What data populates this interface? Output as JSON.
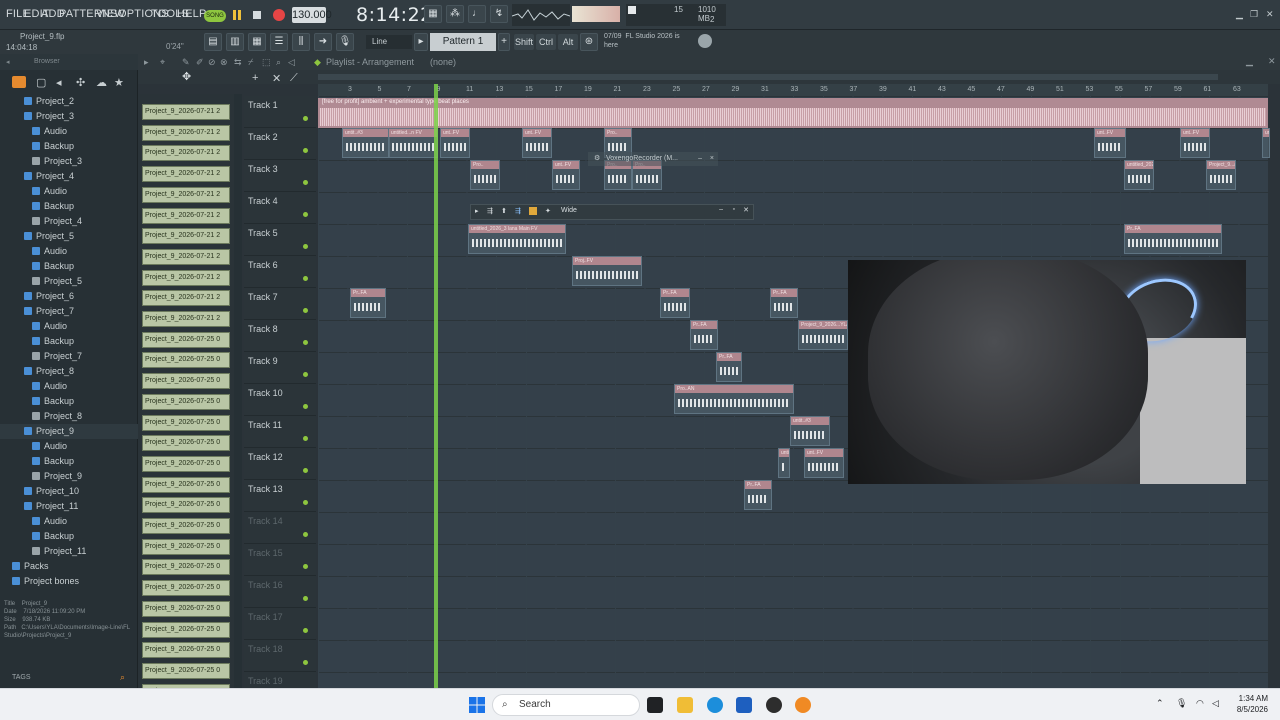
{
  "menu": {
    "items": [
      "FILE",
      "EDIT",
      "ADD",
      "PATTERNS",
      "VIEW",
      "OPTIONS",
      "TOOLS",
      "HELP"
    ],
    "song_label": "SONG",
    "tempo": "130.000",
    "clock": "8:14:22",
    "cpu_value": "15",
    "mem_value": "1010 MB",
    "mem_sub": "2"
  },
  "toolbar": {
    "file_name": "Project_9.flp",
    "file_time": "14:04:18",
    "length": "0'24\"",
    "snap": "Line",
    "pattern": "Pattern 1",
    "shift": "Shift",
    "ctrl": "Ctrl",
    "alt": "Alt",
    "news_date": "07/09",
    "news_text_1": "FL Studio 2026 is",
    "news_text_2": "here"
  },
  "browser": {
    "label": "Browser",
    "items": [
      {
        "text": "Project_2",
        "kind": "project"
      },
      {
        "text": "Project_3",
        "kind": "project"
      },
      {
        "text": "Audio",
        "kind": "folder"
      },
      {
        "text": "Backup",
        "kind": "folder"
      },
      {
        "text": "Project_3",
        "kind": "file"
      },
      {
        "text": "Project_4",
        "kind": "project"
      },
      {
        "text": "Audio",
        "kind": "folder"
      },
      {
        "text": "Backup",
        "kind": "folder"
      },
      {
        "text": "Project_4",
        "kind": "file"
      },
      {
        "text": "Project_5",
        "kind": "project"
      },
      {
        "text": "Audio",
        "kind": "folder"
      },
      {
        "text": "Backup",
        "kind": "folder"
      },
      {
        "text": "Project_5",
        "kind": "file"
      },
      {
        "text": "Project_6",
        "kind": "project"
      },
      {
        "text": "Project_7",
        "kind": "project"
      },
      {
        "text": "Audio",
        "kind": "folder"
      },
      {
        "text": "Backup",
        "kind": "folder"
      },
      {
        "text": "Project_7",
        "kind": "file"
      },
      {
        "text": "Project_8",
        "kind": "project"
      },
      {
        "text": "Audio",
        "kind": "folder"
      },
      {
        "text": "Backup",
        "kind": "folder"
      },
      {
        "text": "Project_8",
        "kind": "file"
      },
      {
        "text": "Project_9",
        "kind": "project"
      },
      {
        "text": "Audio",
        "kind": "folder"
      },
      {
        "text": "Backup",
        "kind": "folder"
      },
      {
        "text": "Project_9",
        "kind": "file"
      },
      {
        "text": "Project_10",
        "kind": "project"
      },
      {
        "text": "Project_11",
        "kind": "project"
      },
      {
        "text": "Audio",
        "kind": "folder"
      },
      {
        "text": "Backup",
        "kind": "folder"
      },
      {
        "text": "Project_11",
        "kind": "file"
      },
      {
        "text": "Packs",
        "kind": "root"
      },
      {
        "text": "Project bones",
        "kind": "root"
      }
    ],
    "info": {
      "title_label": "Title",
      "title": "Project_9",
      "date_label": "Date",
      "date": "7/18/2026 11:09:20 PM",
      "size_label": "Size",
      "size": "938.74 KB",
      "path_label": "Path",
      "path": "C:\\Users\\YLA\\Documents\\Image-Line\\FL Studio\\Projects\\Project_9"
    },
    "tags": "TAGS"
  },
  "clip_source": {
    "items": [
      "Project_9_2026-07-21 2",
      "Project_9_2026-07-21 2",
      "Project_9_2026-07-21 2",
      "Project_9_2026-07-21 2",
      "Project_9_2026-07-21 2",
      "Project_9_2026-07-21 2",
      "Project_9_2026-07-21 2",
      "Project_9_2026-07-21 2",
      "Project_9_2026-07-21 2",
      "Project_9_2026-07-21 2",
      "Project_9_2026-07-21 2",
      "Project_9_2026-07-25 0",
      "Project_9_2026-07-25 0",
      "Project_9_2026-07-25 0",
      "Project_9_2026-07-25 0",
      "Project_9_2026-07-25 0",
      "Project_9_2026-07-25 0",
      "Project_9_2026-07-25 0",
      "Project_9_2026-07-25 0",
      "Project_9_2026-07-25 0",
      "Project_9_2026-07-25 0",
      "Project_9_2026-07-25 0",
      "Project_9_2026-07-25 0",
      "Project_9_2026-07-25 0",
      "Project_9_2026-07-25 0",
      "Project_9_2026-07-25 0",
      "Project_9_2026-07-25 0",
      "Project_9_2026-07-25 0",
      "Project_9_2026-07-25 0"
    ]
  },
  "playlist": {
    "title": "Playlist - Arrangement",
    "arrangement": "(none)",
    "ruler": [
      "3",
      "5",
      "7",
      "9",
      "11",
      "13",
      "15",
      "17",
      "19",
      "21",
      "23",
      "25",
      "27",
      "29",
      "31",
      "33",
      "35",
      "37",
      "39",
      "41",
      "43",
      "45",
      "47",
      "49",
      "51",
      "53",
      "55",
      "57",
      "59",
      "61",
      "63"
    ],
    "tracks": [
      "Track 1",
      "Track 2",
      "Track 3",
      "Track 4",
      "Track 5",
      "Track 6",
      "Track 7",
      "Track 8",
      "Track 9",
      "Track 10",
      "Track 11",
      "Track 12",
      "Track 13",
      "Track 14",
      "Track 15",
      "Track 16",
      "Track 17",
      "Track 18",
      "Track 19"
    ],
    "track1_clip": "[free for profit] ambient + experimental type beat places",
    "clip_labels": [
      "untit..#3",
      "untitled...n FV",
      "unt..FV",
      "unt..FV",
      "Pro..",
      "unt..FV",
      "unt..FV",
      "unt..FV",
      "Pro..",
      "Pro..",
      "unt..FV",
      "Pro..",
      "untitled_2026_3 lana Main FV",
      "Project_9...a Main FV",
      "untitled_2026_3 lana Main FV",
      "Proj..FV",
      "Pr..FA",
      "Pr..FA",
      "Pr..FA",
      "Pr..FA",
      "Pr..FA",
      "Project_9_2026...YLA PRESET TANA",
      "Pr..FA",
      "Pro..AN",
      "Pr..FA"
    ]
  },
  "plugins": {
    "recorder": "VoxengoRecorder (M...",
    "wide_label": "Wide"
  },
  "taskbar": {
    "search": "Search",
    "time": "1:34 AM",
    "date": "8/5/2026"
  },
  "colors": {
    "accent_green": "#8ec63f",
    "clip_pink": "#b08a93",
    "playhead": "#7cd14a"
  }
}
